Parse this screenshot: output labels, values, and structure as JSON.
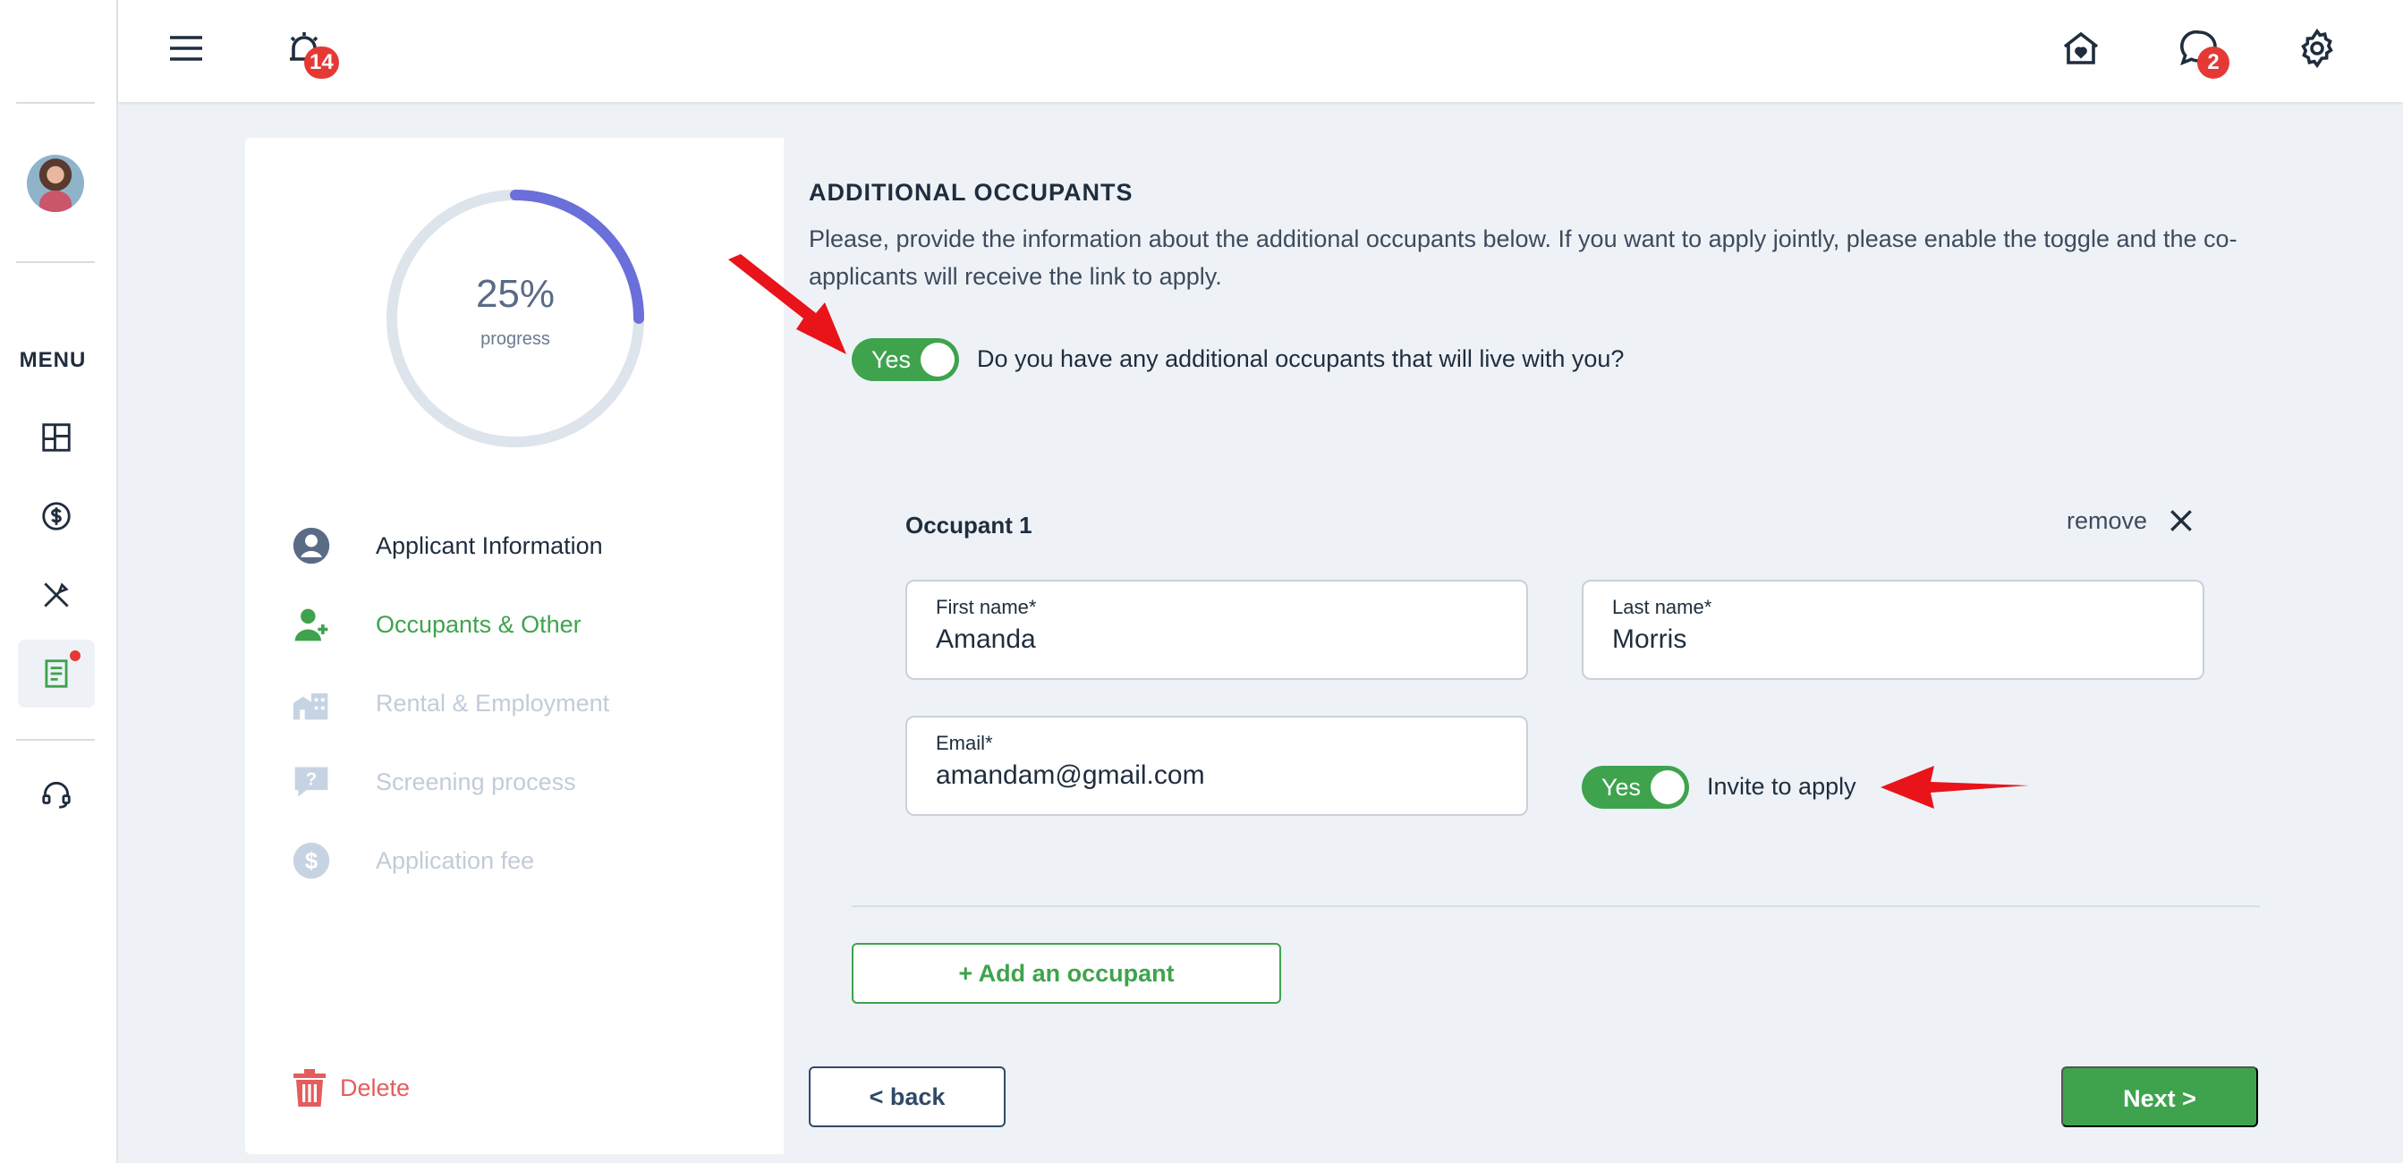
{
  "topbar": {
    "notifications_count": "14",
    "messages_count": "2"
  },
  "sidebar": {
    "menu_label": "MENU",
    "items": [
      {
        "icon": "dashboard-icon"
      },
      {
        "icon": "dollar-icon"
      },
      {
        "icon": "tools-icon"
      },
      {
        "icon": "application-icon",
        "active": true
      },
      {
        "icon": "support-headset-icon"
      }
    ]
  },
  "progress": {
    "value_text": "25%",
    "label": "progress",
    "fraction": 0.25
  },
  "steps": [
    {
      "label": "Applicant Information",
      "state": "done",
      "icon": "user-circle-icon"
    },
    {
      "label": "Occupants & Other",
      "state": "current",
      "icon": "user-add-icon"
    },
    {
      "label": "Rental & Employment",
      "state": "pending",
      "icon": "building-icon"
    },
    {
      "label": "Screening process",
      "state": "pending",
      "icon": "question-bubble-icon"
    },
    {
      "label": "Application fee",
      "state": "pending",
      "icon": "dollar-circle-icon"
    }
  ],
  "delete_label": "Delete",
  "section": {
    "title": "ADDITIONAL OCCUPANTS",
    "description": "Please, provide the information about the additional occupants below. If you want to apply jointly, please enable the toggle and the co-applicants will receive the link to apply.",
    "toggle_label": "Yes",
    "toggle_question": "Do you have any additional occupants that will live with you?"
  },
  "occupant": {
    "title": "Occupant 1",
    "remove_label": "remove",
    "first_name_label": "First name*",
    "first_name_value": "Amanda",
    "last_name_label": "Last name*",
    "last_name_value": "Morris",
    "email_label": "Email*",
    "email_value": "amandam@gmail.com",
    "invite_toggle_label": "Yes",
    "invite_text": "Invite to apply"
  },
  "buttons": {
    "add_occupant": "+ Add an occupant",
    "back": "< back",
    "next": "Next >"
  },
  "colors": {
    "accent_green": "#3fa34d",
    "progress_arc": "#6b6fd9",
    "danger": "#e35d5d",
    "annotation_red": "#e8141a"
  }
}
